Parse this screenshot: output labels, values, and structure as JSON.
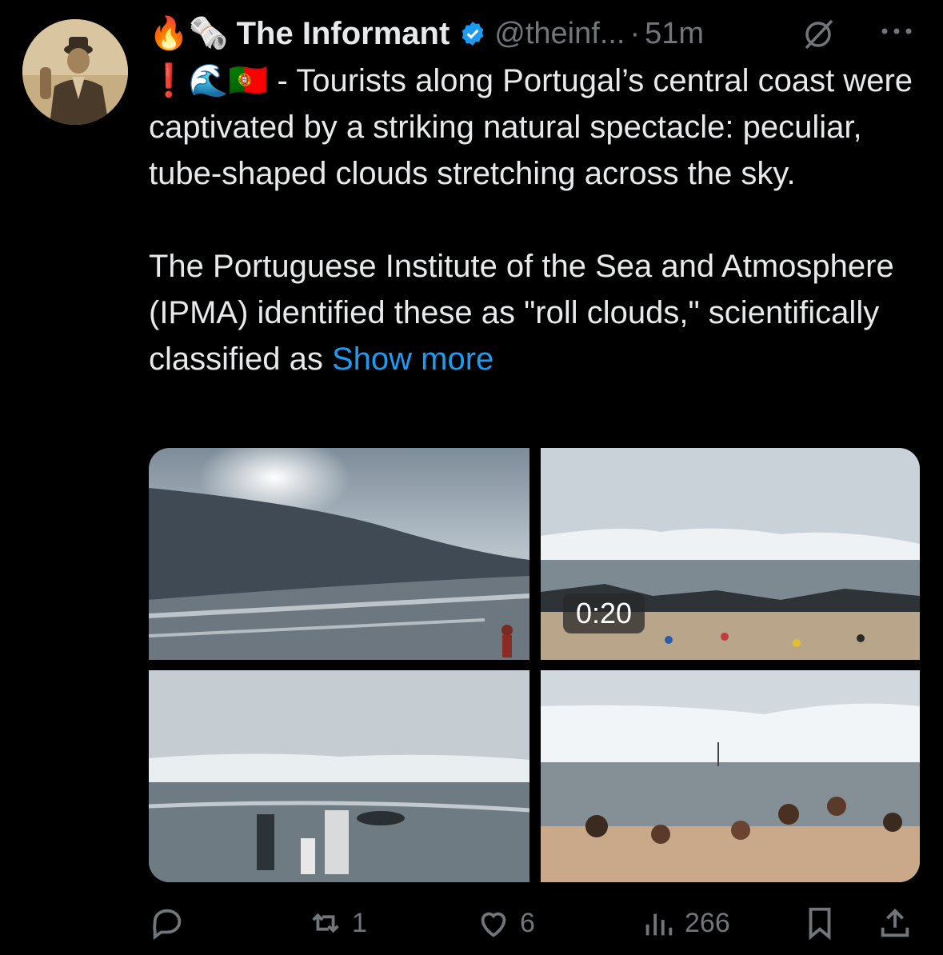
{
  "tweet": {
    "emoji_prefix": "🔥🗞️",
    "author_name": "The Informant",
    "handle": "@theinf...",
    "separator": "·",
    "time": "51m",
    "emoji_line": "❗🌊🇵🇹",
    "paragraph1": " - Tourists along Portugal’s central coast were captivated by a striking natural spectacle: peculiar, tube-shaped clouds stretching across the sky.",
    "paragraph2": "The Portuguese Institute of the Sea and Atmosphere (IPMA) identified these as \"roll clouds,\" scientifically classified as ",
    "show_more": "Show more"
  },
  "media": {
    "video_duration": "0:20"
  },
  "actions": {
    "reply_count": "",
    "retweet_count": "1",
    "like_count": "6",
    "views_count": "266"
  },
  "colors": {
    "background": "#000000",
    "text": "#e7e9ea",
    "muted": "#71767b",
    "accent": "#1d9bf0"
  },
  "icons": [
    "grok-icon",
    "more-icon",
    "verified-icon",
    "reply-icon",
    "retweet-icon",
    "like-icon",
    "views-icon",
    "bookmark-icon",
    "share-icon"
  ]
}
